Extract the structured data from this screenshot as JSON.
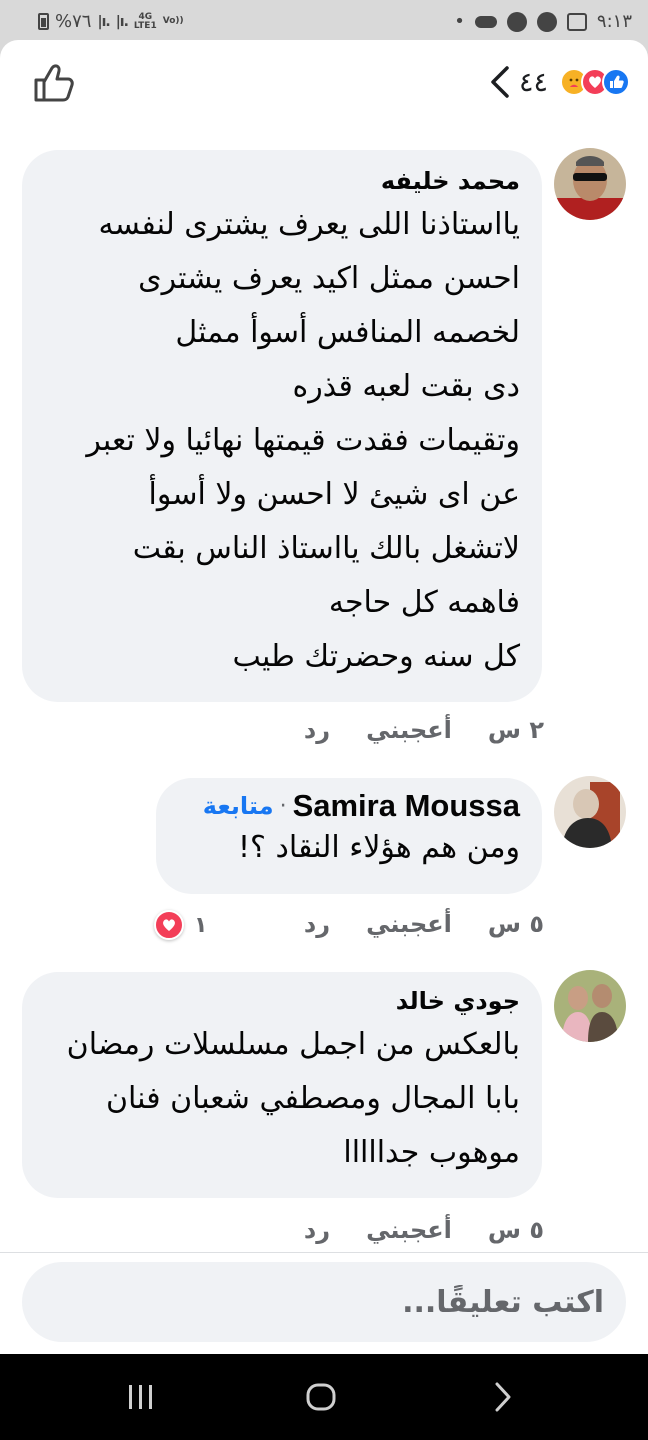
{
  "status_bar": {
    "battery": "%٧٦",
    "signal_1": "|ı.",
    "signal_2": "|ı.",
    "network_top": "4G",
    "network_bottom": "LTE1",
    "volte": "Vo))",
    "time": "٩:١٣"
  },
  "header": {
    "reaction_count": "٤٤",
    "reactions": [
      "care",
      "love",
      "like"
    ]
  },
  "comments": [
    {
      "author": "محمد خليفه",
      "text": "يااستاذنا اللى يعرف يشترى لنفسه\nاحسن ممثل اكيد يعرف يشترى\nلخصمه المنافس أسوأ ممثل\nدى بقت لعبه قذره\nوتقيمات فقدت قيمتها نهائيا ولا تعبر\nعن اى شيئ لا احسن ولا أسوأ\nلاتشغل بالك يااستاذ الناس بقت\nفاهمه كل حاجه\nكل سنه وحضرتك طيب",
      "time": "٢ س",
      "like_label": "أعجبني",
      "reply_label": "رد"
    },
    {
      "author": "Samira Moussa",
      "follow_label": "متابعة",
      "text": "ومن هم هؤلاء النقاد ؟!",
      "time": "٥ س",
      "like_label": "أعجبني",
      "reply_label": "رد",
      "reaction_count": "١",
      "reaction": "love"
    },
    {
      "author": "جودي خالد",
      "text": "بالعكس من اجمل مسلسلات رمضان\nبابا المجال ومصطفي شعبان فنان\nموهوب جدااااا",
      "time": "٥ س",
      "like_label": "أعجبني",
      "reply_label": "رد"
    }
  ],
  "composer": {
    "placeholder": "اكتب تعليقًا..."
  },
  "colors": {
    "accent": "#1877f2",
    "bubble": "#f0f2f5",
    "love": "#f33e58"
  }
}
